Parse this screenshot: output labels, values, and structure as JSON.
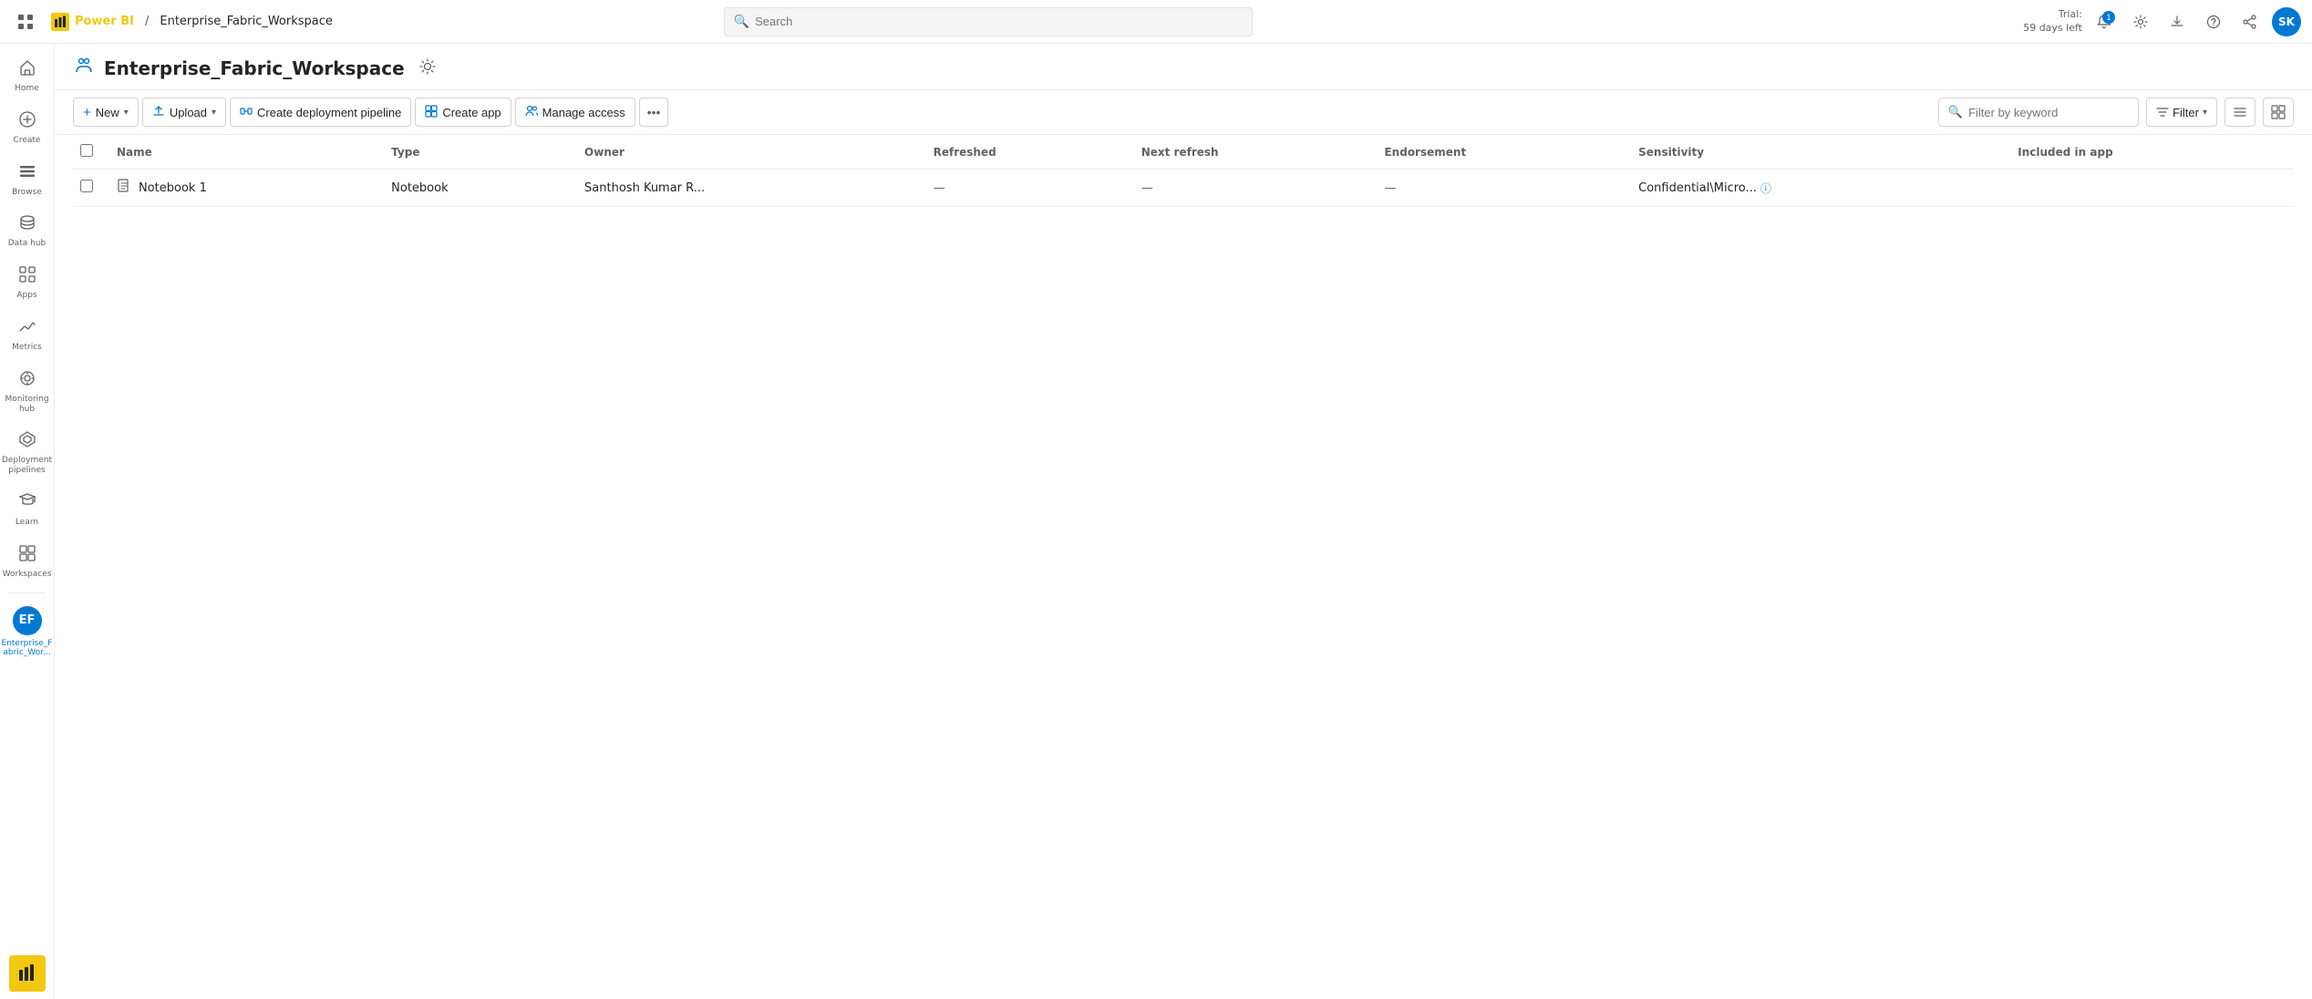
{
  "topbar": {
    "apps_icon": "⊞",
    "powerbi_label": "Power BI",
    "breadcrumb_separator": "/",
    "workspace_name": "Enterprise_Fabric_Workspace",
    "search_placeholder": "Search",
    "trial_label": "Trial:",
    "days_left": "59 days left",
    "notification_count": "1",
    "avatar_initials": "SK"
  },
  "sidebar": {
    "items": [
      {
        "id": "home",
        "icon": "⌂",
        "label": "Home",
        "active": false
      },
      {
        "id": "create",
        "icon": "+",
        "label": "Create",
        "active": false
      },
      {
        "id": "browse",
        "icon": "☰",
        "label": "Browse",
        "active": false
      },
      {
        "id": "datahub",
        "icon": "◈",
        "label": "Data hub",
        "active": false
      },
      {
        "id": "apps",
        "icon": "⧉",
        "label": "Apps",
        "active": false
      },
      {
        "id": "metrics",
        "icon": "◎",
        "label": "Metrics",
        "active": false
      },
      {
        "id": "monitoring",
        "icon": "◉",
        "label": "Monitoring hub",
        "active": false
      },
      {
        "id": "deployment",
        "icon": "⬡",
        "label": "Deployment pipelines",
        "active": false
      },
      {
        "id": "learn",
        "icon": "📖",
        "label": "Learn",
        "active": false
      },
      {
        "id": "workspaces",
        "icon": "⊞",
        "label": "Workspaces",
        "active": false
      }
    ],
    "workspace_item": {
      "label": "Enterprise_F abric_Wor...",
      "short": "EF",
      "active": true
    },
    "powerbi_bottom_label": "Power BI"
  },
  "workspace_header": {
    "title": "Enterprise_Fabric_Workspace",
    "settings_tooltip": "Settings"
  },
  "toolbar": {
    "new_label": "New",
    "upload_label": "Upload",
    "create_pipeline_label": "Create deployment pipeline",
    "create_app_label": "Create app",
    "manage_access_label": "Manage access",
    "more_icon": "•••",
    "filter_placeholder": "Filter by keyword",
    "filter_label": "Filter",
    "view_list_icon": "≡",
    "view_grid_icon": "⊞"
  },
  "table": {
    "columns": [
      {
        "id": "name",
        "label": "Name"
      },
      {
        "id": "type",
        "label": "Type"
      },
      {
        "id": "owner",
        "label": "Owner"
      },
      {
        "id": "refreshed",
        "label": "Refreshed"
      },
      {
        "id": "next_refresh",
        "label": "Next refresh"
      },
      {
        "id": "endorsement",
        "label": "Endorsement"
      },
      {
        "id": "sensitivity",
        "label": "Sensitivity"
      },
      {
        "id": "included_in_app",
        "label": "Included in app"
      }
    ],
    "rows": [
      {
        "icon": "📓",
        "name": "Notebook 1",
        "type": "Notebook",
        "owner": "Santhosh Kumar R...",
        "refreshed": "—",
        "next_refresh": "—",
        "endorsement": "—",
        "sensitivity": "Confidential\\Micro...",
        "sensitivity_has_info": true,
        "included_in_app": ""
      }
    ]
  }
}
